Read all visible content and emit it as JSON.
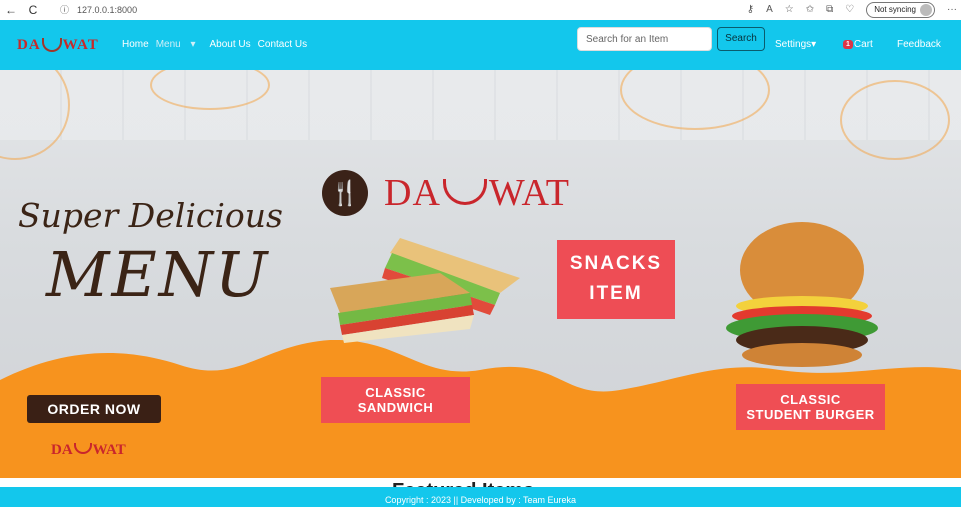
{
  "browser": {
    "url": "127.0.0.1:8000",
    "sync_label": "Not syncing",
    "back_glyph": "←",
    "reload_glyph": "C",
    "info_glyph": "ⓘ",
    "more_glyph": "···"
  },
  "navbar": {
    "brand": "DA",
    "brand_suffix": "WAT",
    "links": [
      "Home",
      "Menu",
      "About Us",
      "Contact Us"
    ],
    "search_placeholder": "Search for an Item",
    "search_button": "Search",
    "settings": "Settings",
    "cart_count": "1",
    "cart": "Cart",
    "feedback": "Feedback"
  },
  "hero": {
    "brand": "DA",
    "brand_suffix": "WAT",
    "tagline_top": "Super Delicious",
    "tagline_big": "MENU",
    "order_button": "ORDER NOW",
    "snacks_line1": "SNACKS",
    "snacks_line2": "ITEM",
    "item1_line1": "CLASSIC",
    "item1_line2": "SANDWICH",
    "item2_line1": "CLASSIC",
    "item2_line2": "STUDENT BURGER",
    "small_brand": "DA",
    "small_brand_suffix": "WAT"
  },
  "section": {
    "partial_heading": "Featured Items"
  },
  "footer": {
    "text": "Copyright : 2023 || Developed by : Team Eureka"
  },
  "colors": {
    "navbar": "#13c7ec",
    "accent_red": "#ef4e54",
    "orange": "#f7931e",
    "brown": "#3a2015"
  }
}
